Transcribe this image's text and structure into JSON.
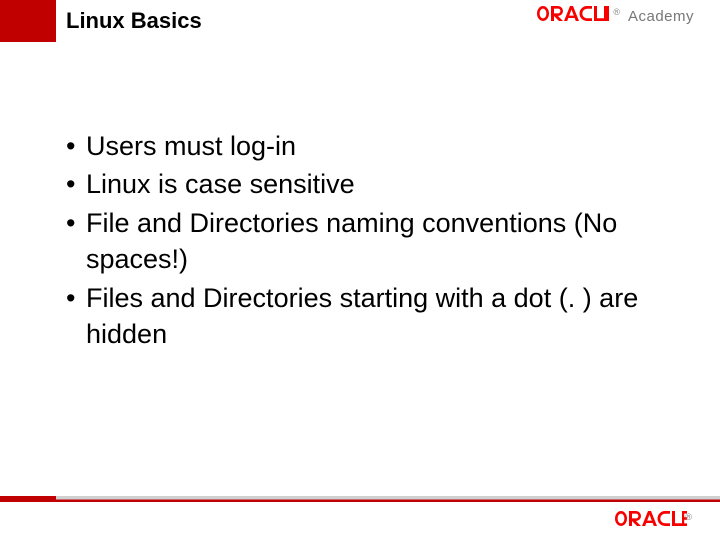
{
  "header": {
    "title": "Linux Basics",
    "brand": {
      "name": "ORACLE",
      "suffix": "Academy"
    }
  },
  "bullets": [
    "Users must log-in",
    "Linux is case sensitive",
    "File and Directories naming conventions (No spaces!)",
    "Files and Directories starting with a dot (. ) are hidden"
  ],
  "footer": {
    "brand": {
      "name": "ORACLE"
    }
  },
  "colors": {
    "accent": "#c00000"
  }
}
